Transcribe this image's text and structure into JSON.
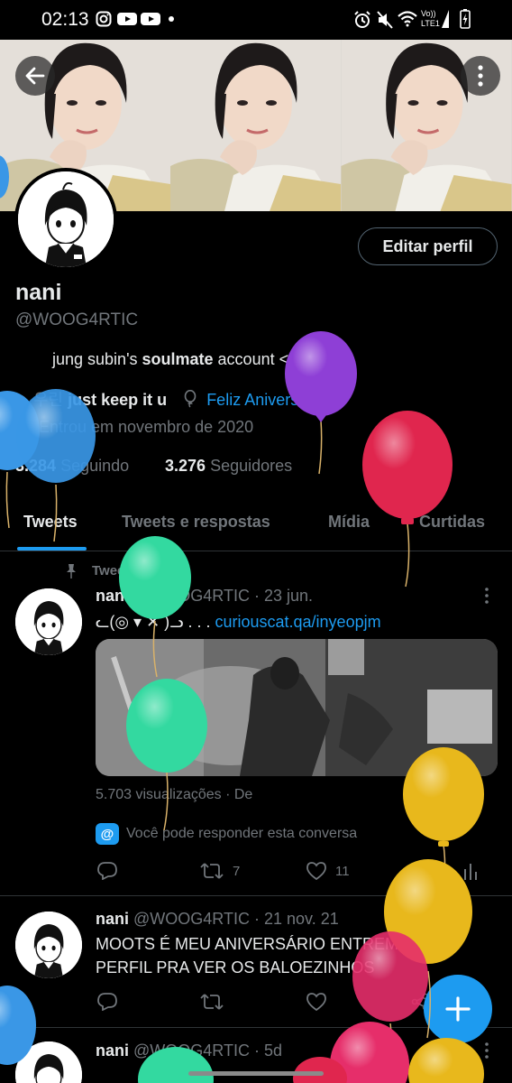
{
  "status_bar": {
    "time": "02:13",
    "icons": [
      "instagram-icon",
      "youtube-icon",
      "youtube-icon",
      "dot-icon",
      "alarm-icon",
      "mute-icon",
      "wifi-icon",
      "volte-icon",
      "battery-charging-icon"
    ],
    "network_label_top": "Vo))",
    "network_label_bottom": "LTE1"
  },
  "header": {
    "back_icon": "arrow-left-icon",
    "more_icon": "more-vertical-icon"
  },
  "profile": {
    "edit_button": "Editar perfil",
    "name": "nani",
    "handle": "@WOOG4RTIC",
    "bio_prefix": "jung subin's ",
    "bio_bold": "soulmate",
    "bio_suffix": " account <3",
    "location_prefix": "우린 ",
    "location_bold": "just keep it u",
    "birthday": "Feliz Aniversário!",
    "joined": "Entrou em novembro de 2020",
    "following_count": "3.284",
    "following_label": "Seguindo",
    "followers_count": "3.276",
    "followers_label": "Seguidores"
  },
  "tabs": [
    {
      "label": "Tweets",
      "active": true
    },
    {
      "label": "Tweets e respostas",
      "active": false
    },
    {
      "label": "Mídia",
      "active": false
    },
    {
      "label": "Curtidas",
      "active": false
    }
  ],
  "tweets": [
    {
      "pinned_label": "Tweet Fixado",
      "name": "nani",
      "handle": "@WOOG4RTIC",
      "date": "· 23 jun.",
      "text_prefix": "ᓚ(◎ ▾ ✕ )ᓗ . . . ",
      "text_link": "curiouscat.qa/inyeopjm",
      "views": "5.703 visualizações",
      "views_suffix": "· De",
      "reply_note": "Você pode responder esta conversa",
      "retweets": "7",
      "likes": "11"
    },
    {
      "name": "nani",
      "handle": "@WOOG4RTIC",
      "date": "· 21 nov. 21",
      "text": "MOOTS É MEU ANIVERSÁRIO ENTREM NO PERFIL PRA VER OS BALOEZINHOS"
    },
    {
      "name": "nani",
      "handle": "@WOOG4RTIC",
      "date": "· 5d"
    }
  ],
  "fab_icon": "plus-icon",
  "colors": {
    "accent": "#1d9bf0",
    "text_primary": "#e7e9ea",
    "text_secondary": "#71767b",
    "balloon_blue": "#3a97e6",
    "balloon_purple": "#8e3fd6",
    "balloon_red": "#e0264e",
    "balloon_green": "#33d9a0",
    "balloon_yellow": "#e8b81c",
    "balloon_pink": "#e62e6a"
  }
}
